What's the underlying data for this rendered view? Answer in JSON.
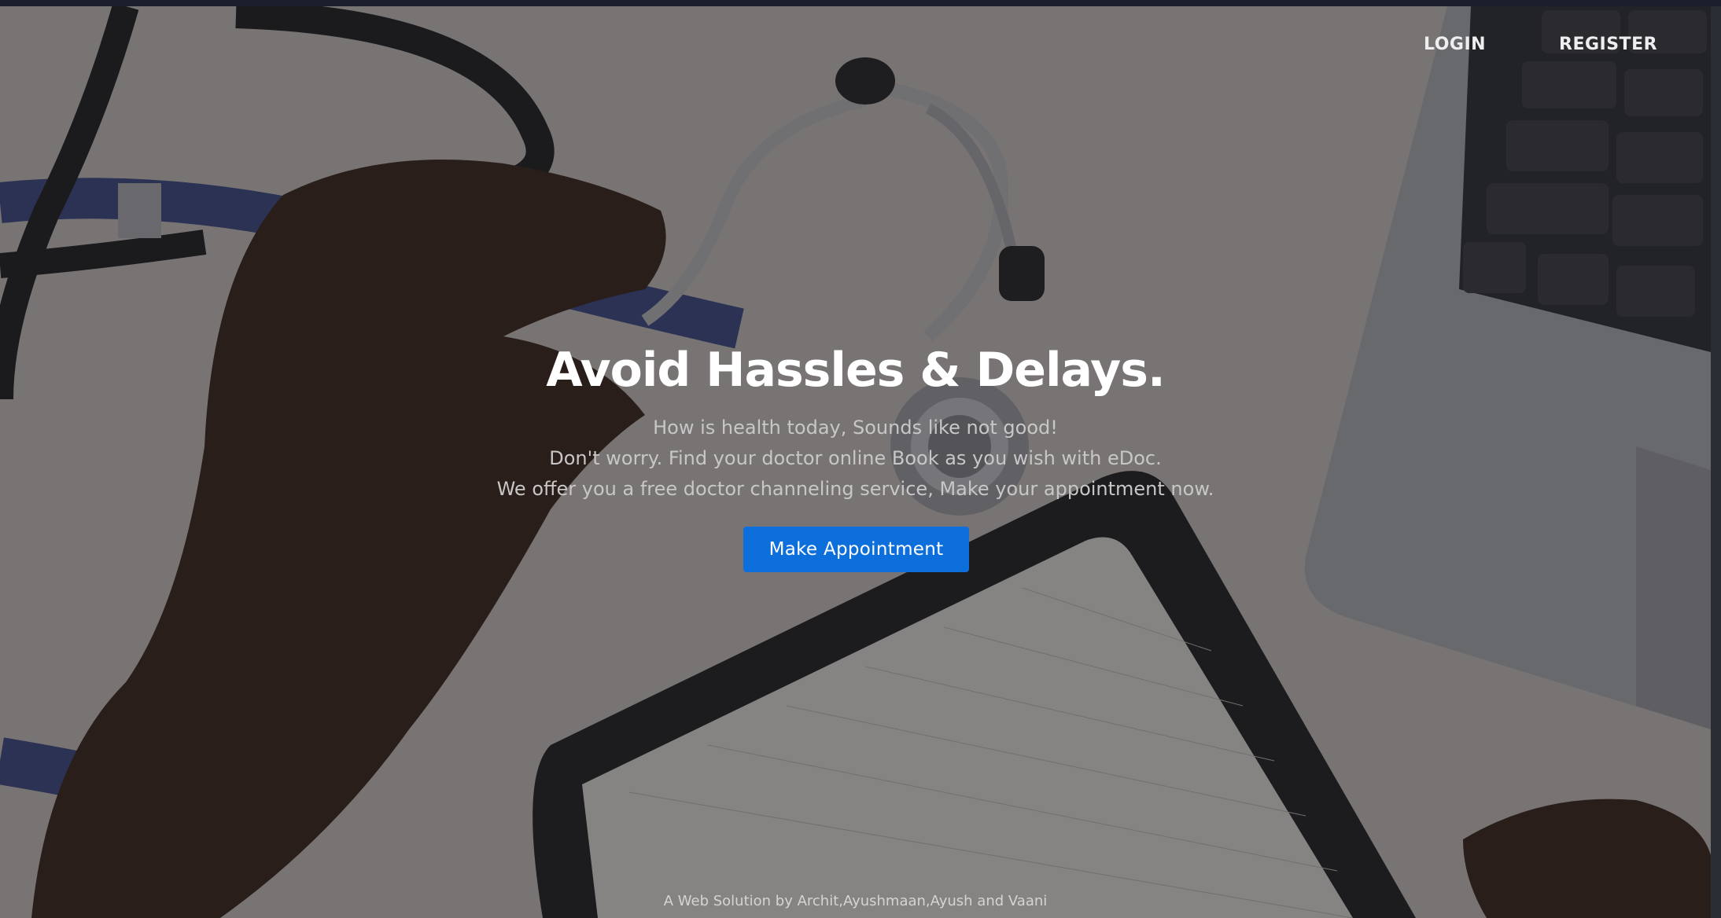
{
  "nav": {
    "login_label": "LOGIN",
    "register_label": "REGISTER"
  },
  "hero": {
    "title": "Avoid Hassles & Delays.",
    "subtitle_lines": [
      "How is health today, Sounds like not good!",
      "Don't worry. Find your doctor online Book as you wish with eDoc.",
      "We offer you a free doctor channeling service, Make your appointment now."
    ],
    "cta_label": "Make Appointment",
    "background_image": "stethoscope-laptop-tablet-photo"
  },
  "footer": {
    "credit": "A Web Solution by Archit,Ayushmaan,Ayush and Vaani"
  },
  "colors": {
    "accent": "#0d6fdc",
    "overlay": "rgba(25,25,30,0.50)",
    "text_primary": "#ffffff",
    "text_secondary": "#c8c6c6"
  }
}
